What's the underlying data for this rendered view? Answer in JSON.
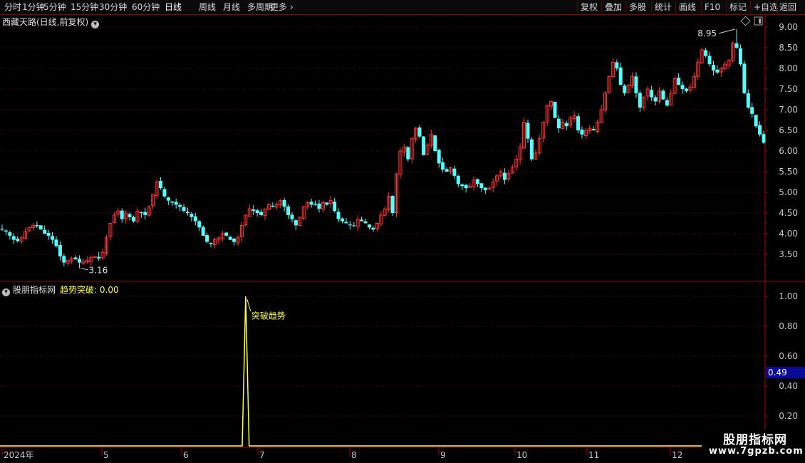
{
  "toolbar": {
    "left_items": [
      "分时",
      "1分钟",
      "5分钟",
      "15分钟",
      "30分钟",
      "60分钟",
      "日线",
      "周线",
      "月线",
      "多周期",
      "更多"
    ],
    "active": "日线",
    "right_items": [
      "复权",
      "叠加",
      "多股",
      "统计",
      "画线",
      "F10",
      "标记",
      "+自选",
      "返回"
    ]
  },
  "main_panel": {
    "title": "西藏天路(日线,前复权)",
    "high_label": "8.95",
    "low_label": "3.16"
  },
  "indicator_panel": {
    "source": "股朋指标网",
    "name": "趋势突破:",
    "value": "0.00",
    "signal_label": "突破趋势",
    "cursor_value": "0.49"
  },
  "watermark": {
    "line1": "股朋指标网",
    "line2": "www.7gpzb.com"
  },
  "colors": {
    "up": "#ff3232",
    "down": "#54fcfc",
    "indicator": "#ffff40",
    "grid": "#7a0000",
    "axis": "#b00000"
  },
  "chart_data": [
    {
      "type": "candlestick",
      "title": "西藏天路(日线,前复权)",
      "ylim": [
        3.0,
        9.3
      ],
      "y_ticks": [
        3.5,
        4.0,
        4.5,
        5.0,
        5.5,
        6.0,
        6.5,
        7.0,
        7.5,
        8.0,
        8.5,
        9.0
      ],
      "y_tick_labels": [
        "3.50",
        "4.00",
        "4.50",
        "5.00",
        "5.50",
        "6.00",
        "6.50",
        "7.00",
        "7.50",
        "8.00",
        "8.50",
        "9.00"
      ],
      "x_tick_labels": [
        "2024年",
        "5",
        "6",
        "7",
        "8",
        "9",
        "10",
        "11",
        "12"
      ],
      "close": [
        4.1,
        4.05,
        3.95,
        3.85,
        3.82,
        3.9,
        4.05,
        4.15,
        4.2,
        4.18,
        4.1,
        4.0,
        3.95,
        3.85,
        3.7,
        3.45,
        3.3,
        3.35,
        3.4,
        3.38,
        3.3,
        3.32,
        3.35,
        3.42,
        3.45,
        3.4,
        3.55,
        3.9,
        4.25,
        4.45,
        4.55,
        4.35,
        4.5,
        4.4,
        4.3,
        4.55,
        4.5,
        4.45,
        4.65,
        4.95,
        5.25,
        5.1,
        4.9,
        4.8,
        4.75,
        4.7,
        4.65,
        4.55,
        4.5,
        4.4,
        4.3,
        4.15,
        3.95,
        3.8,
        3.75,
        3.85,
        3.9,
        4.0,
        3.95,
        3.85,
        3.8,
        3.9,
        4.2,
        4.45,
        4.6,
        4.55,
        4.5,
        4.45,
        4.6,
        4.7,
        4.65,
        4.7,
        4.8,
        4.65,
        4.45,
        4.35,
        4.2,
        4.4,
        4.65,
        4.75,
        4.7,
        4.7,
        4.6,
        4.75,
        4.7,
        4.8,
        4.55,
        4.35,
        4.3,
        4.25,
        4.2,
        4.2,
        4.35,
        4.3,
        4.25,
        4.15,
        4.1,
        4.25,
        4.45,
        4.6,
        4.9,
        4.5,
        5.45,
        6.0,
        6.1,
        5.8,
        6.3,
        6.55,
        6.35,
        5.9,
        6.15,
        6.4,
        6.0,
        5.7,
        5.55,
        5.5,
        5.6,
        5.4,
        5.2,
        5.15,
        5.1,
        5.15,
        5.3,
        5.2,
        5.1,
        5.05,
        5.1,
        5.25,
        5.4,
        5.5,
        5.3,
        5.45,
        5.6,
        5.8,
        6.1,
        6.7,
        6.3,
        5.8,
        5.95,
        6.3,
        6.7,
        7.1,
        7.2,
        6.8,
        6.55,
        6.7,
        6.6,
        6.8,
        6.85,
        6.5,
        6.4,
        6.5,
        6.55,
        6.5,
        6.7,
        7.0,
        7.4,
        7.8,
        8.15,
        8.0,
        7.6,
        7.4,
        7.6,
        7.8,
        7.4,
        7.05,
        7.3,
        7.5,
        7.3,
        7.2,
        7.45,
        7.25,
        7.1,
        7.4,
        7.75,
        7.6,
        7.5,
        7.45,
        7.55,
        7.8,
        8.15,
        8.45,
        8.3,
        8.1,
        7.95,
        7.9,
        8.0,
        8.1,
        8.2,
        8.6,
        8.5,
        8.1,
        7.4,
        7.05,
        6.9,
        6.6,
        6.4,
        6.2
      ]
    },
    {
      "type": "line",
      "series": [
        {
          "name": "趋势突破",
          "values": "0 on every day except 1.00 on one day (index 63, just after the 6→7 month boundary)"
        }
      ],
      "signal_index": 63,
      "signal_value": 1.0,
      "ylim": [
        0.0,
        1.1
      ],
      "y_ticks": [
        0.2,
        0.4,
        0.6,
        0.8,
        1.0
      ],
      "y_tick_labels": [
        "0.20",
        "0.40",
        "0.60",
        "0.80",
        "1.00"
      ]
    }
  ]
}
